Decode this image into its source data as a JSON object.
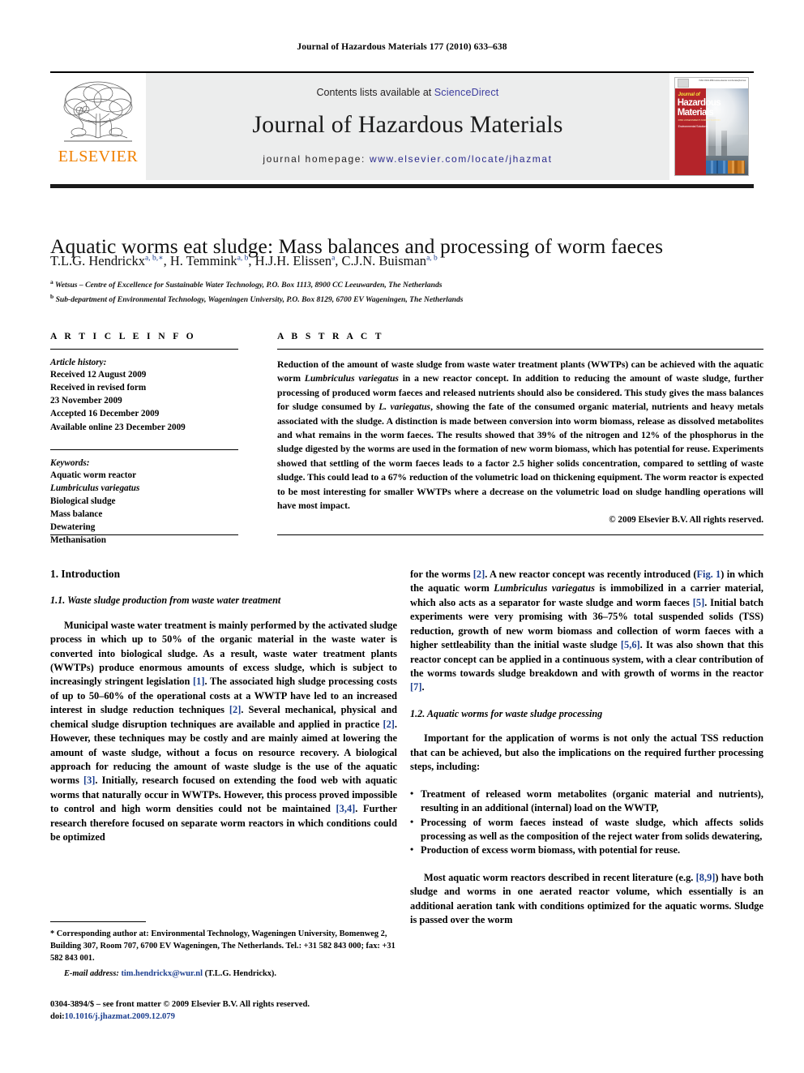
{
  "running_head": "Journal of Hazardous Materials 177 (2010) 633–638",
  "masthead": {
    "publisher_name": "ELSEVIER",
    "contents_prefix": "Contents lists available at ",
    "contents_link": "ScienceDirect",
    "journal_title": "Journal of Hazardous Materials",
    "homepage_prefix": "journal homepage: ",
    "homepage_url": "www.elsevier.com/locate/jhazmat",
    "cover": {
      "journal_of": "Journal of",
      "line1": "Hazardous",
      "line2": "Materials",
      "subtitle": "RISK ASSESSMENT AND MITIGATION",
      "subtitle2": "Environmental Solutions",
      "issue_note": "ISSN 0304-3894\nwww.elsevier.com/locate/jhazmat"
    }
  },
  "article": {
    "title": "Aquatic worms eat sludge: Mass balances and processing of worm faeces",
    "authors": [
      {
        "name": "T.L.G. Hendrickx",
        "marks": "a, b,∗"
      },
      {
        "name": "H. Temmink",
        "marks": "a, b"
      },
      {
        "name": "H.J.H. Elissen",
        "marks": "a"
      },
      {
        "name": "C.J.N. Buisman",
        "marks": "a, b"
      }
    ],
    "affiliations": [
      {
        "mark": "a",
        "text": "Wetsus – Centre of Excellence for Sustainable Water Technology, P.O. Box 1113, 8900 CC Leeuwarden, The Netherlands"
      },
      {
        "mark": "b",
        "text": "Sub-department of Environmental Technology, Wageningen University, P.O. Box 8129, 6700 EV Wageningen, The Netherlands"
      }
    ]
  },
  "article_info": {
    "heading": "A R T I C L E    I N F O",
    "history_label": "Article history:",
    "history": [
      "Received 12 August 2009",
      "Received in revised form",
      "23 November 2009",
      "Accepted 16 December 2009",
      "Available online 23 December 2009"
    ],
    "keywords_label": "Keywords:",
    "keywords": [
      "Aquatic worm reactor",
      "Lumbriculus variegatus",
      "Biological sludge",
      "Mass balance",
      "Dewatering",
      "Methanisation"
    ],
    "keyword_italic_index": 1
  },
  "abstract": {
    "heading": "A B S T R A C T",
    "part1": "Reduction of the amount of waste sludge from waste water treatment plants (WWTPs) can be achieved with the aquatic worm ",
    "species1": "Lumbriculus variegatus",
    "part2": " in a new reactor concept. In addition to reducing the amount of waste sludge, further processing of produced worm faeces and released nutrients should also be considered. This study gives the mass balances for sludge consumed by ",
    "species2": "L. variegatus",
    "part3": ", showing the fate of the consumed organic material, nutrients and heavy metals associated with the sludge. A distinction is made between conversion into worm biomass, release as dissolved metabolites and what remains in the worm faeces. The results showed that 39% of the nitrogen and 12% of the phosphorus in the sludge digested by the worms are used in the formation of new worm biomass, which has potential for reuse. Experiments showed that settling of the worm faeces leads to a factor 2.5 higher solids concentration, compared to settling of waste sludge. This could lead to a 67% reduction of the volumetric load on thickening equipment. The worm reactor is expected to be most interesting for smaller WWTPs where a decrease on the volumetric load on sludge handling operations will have most impact.",
    "copyright": "© 2009 Elsevier B.V. All rights reserved."
  },
  "body": {
    "section1_heading": "1.  Introduction",
    "subsection11_heading": "1.1.  Waste sludge production from waste water treatment",
    "p1_a": "Municipal waste water treatment is mainly performed by the activated sludge process in which up to 50% of the organic material in the waste water is converted into biological sludge. As a result, waste water treatment plants (WWTPs) produce enormous amounts of excess sludge, which is subject to increasingly stringent legislation ",
    "p1_r1": "[1]",
    "p1_b": ". The associated high sludge processing costs of up to 50–60% of the operational costs at a WWTP have led to an increased interest in sludge reduction techniques ",
    "p1_r2": "[2]",
    "p1_c": ". Several mechanical, physical and chemical sludge disruption techniques are available and applied in practice ",
    "p1_r3": "[2]",
    "p1_d": ". However, these techniques may be costly and are mainly aimed at lowering the amount of waste sludge, without a focus on resource recovery. A biological approach for reducing the amount of waste sludge is the use of the aquatic worms ",
    "p1_r4": "[3]",
    "p1_e": ". Initially, research focused on extending the food web with aquatic worms that naturally occur in WWTPs. However, this process proved impossible to control and high worm densities could not be maintained ",
    "p1_r5": "[3,4]",
    "p1_f": ". Further research therefore focused on separate worm reactors in which conditions could be optimized",
    "p2_a": "for the worms ",
    "p2_r1": "[2]",
    "p2_b": ". A new reactor concept was recently introduced (",
    "p2_fig": "Fig. 1",
    "p2_c": ") in which the aquatic worm ",
    "p2_species": "Lumbriculus variegatus",
    "p2_d": " is immobilized in a carrier material, which also acts as a separator for waste sludge and worm faeces ",
    "p2_r2": "[5]",
    "p2_e": ". Initial batch experiments were very promising with 36–75% total suspended solids (TSS) reduction, growth of new worm biomass and collection of worm faeces with a higher settleability than the initial waste sludge ",
    "p2_r3": "[5,6]",
    "p2_f": ". It was also shown that this reactor concept can be applied in a continuous system, with a clear contribution of the worms towards sludge breakdown and with growth of worms in the reactor ",
    "p2_r4": "[7]",
    "p2_g": ".",
    "subsection12_heading": "1.2.  Aquatic worms for waste sludge processing",
    "p3": "Important for the application of worms is not only the actual TSS reduction that can be achieved, but also the implications on the required further processing steps, including:",
    "bullets": [
      "Treatment of released worm metabolites (organic material and nutrients), resulting in an additional (internal) load on the WWTP,",
      "Processing of worm faeces instead of waste sludge, which affects solids processing as well as the composition of the reject water from solids dewatering,",
      "Production of excess worm biomass, with potential for reuse."
    ],
    "p4_a": "Most aquatic worm reactors described in recent literature (e.g. ",
    "p4_r1": "[8,9]",
    "p4_b": ") have both sludge and worms in one aerated reactor volume, which essentially is an additional aeration tank with conditions optimized for the aquatic worms. Sludge is passed over the worm"
  },
  "footnotes": {
    "corresponding": "* Corresponding author at: Environmental Technology, Wageningen University, Bomenweg 2, Building 307, Room 707, 6700 EV Wageningen, The Netherlands. Tel.: +31 582 843 000; fax: +31 582 843 001.",
    "email_label": "E-mail address:",
    "email_address": "tim.hendrickx@wur.nl",
    "email_owner": "(T.L.G. Hendrickx).",
    "imprint_line": "0304-3894/$ – see front matter © 2009 Elsevier B.V. All rights reserved.",
    "doi_label": "doi:",
    "doi_value": "10.1016/j.jhazmat.2009.12.079"
  }
}
